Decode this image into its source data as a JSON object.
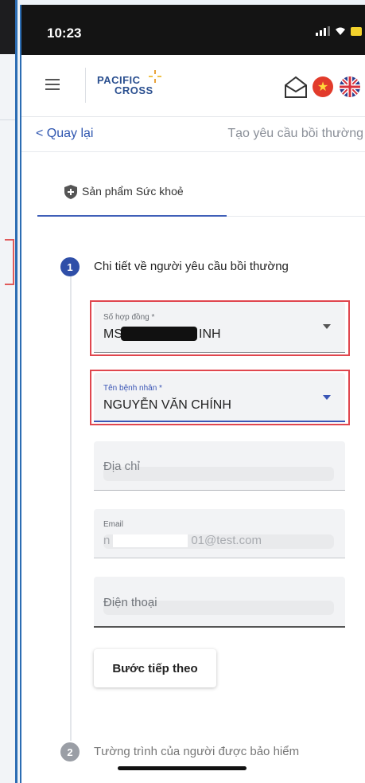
{
  "status": {
    "time": "10:23"
  },
  "brand": {
    "line1": "PACIFIC",
    "line2": "CROSS"
  },
  "nav": {
    "back_label": "< Quay lại",
    "page_title": "Tạo yêu cầu bồi thường"
  },
  "tab": {
    "label": "Sản phẩm Sức khoẻ"
  },
  "steps": [
    {
      "number": "1",
      "title": "Chi tiết về người yêu cầu bồi thường"
    },
    {
      "number": "2",
      "title": "Tường trình của người được bảo hiểm"
    }
  ],
  "form": {
    "contract": {
      "label": "Số hợp đồng *",
      "value_prefix": "MS",
      "value_suffix": "INH"
    },
    "patient": {
      "label": "Tên bệnh nhân *",
      "value": "NGUYỄN VĂN CHÍNH"
    },
    "address": {
      "placeholder": "Địa chỉ"
    },
    "email": {
      "label": "Email",
      "value_prefix": "n",
      "value_suffix": "01@test.com"
    },
    "phone": {
      "placeholder": "Điện thoại"
    }
  },
  "buttons": {
    "next_label": "Bước tiếp theo"
  },
  "colors": {
    "accent": "#3a55b5",
    "highlight": "#e0464e",
    "brand": "#2a4f8f"
  }
}
